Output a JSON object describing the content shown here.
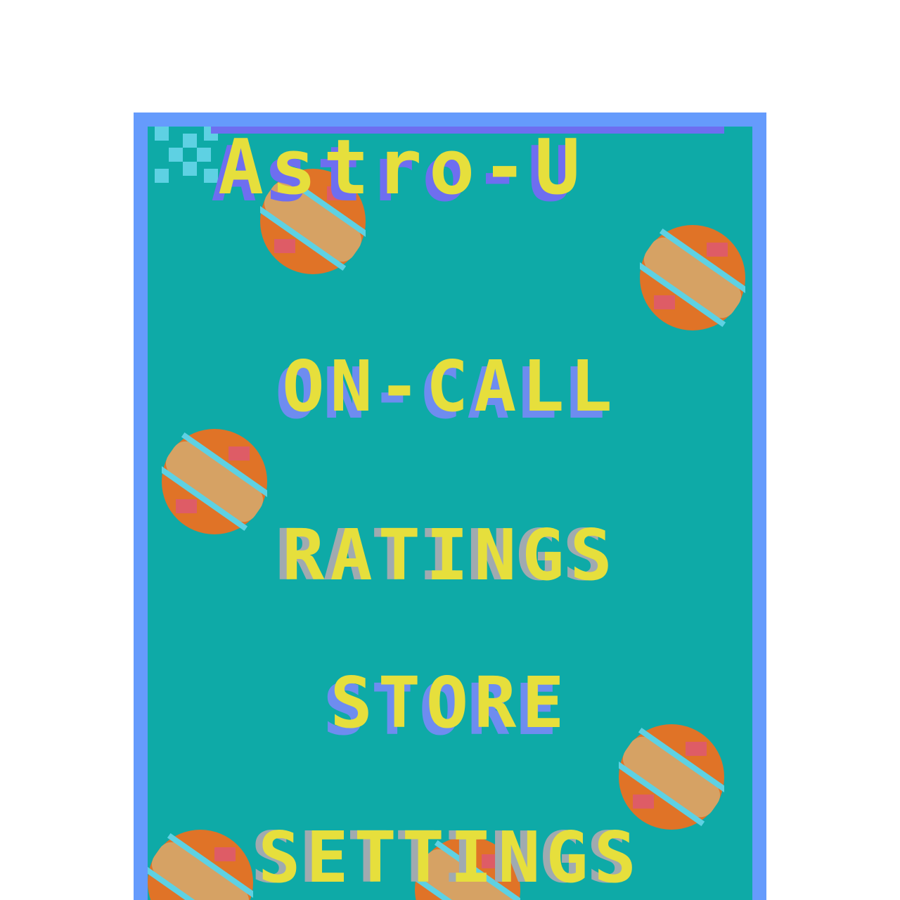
{
  "game": {
    "title": "Astro-U"
  },
  "menu": {
    "on_call": "ON-CALL",
    "ratings": "RATINGS",
    "store": "STORE",
    "settings": "SETTINGS"
  },
  "colors": {
    "frame": "#659bfc",
    "background": "#0eaaa7",
    "text": "#e6df3c",
    "text_shadow_blue": "#6e8cf0",
    "text_shadow_gray": "#a0aab0",
    "bun": "#e07327",
    "meat": "#d6a264",
    "ketchup": "#de5c66",
    "sparkle": "#5ed1e3"
  },
  "icons": [
    "sparkle-icon",
    "burger-icon"
  ]
}
